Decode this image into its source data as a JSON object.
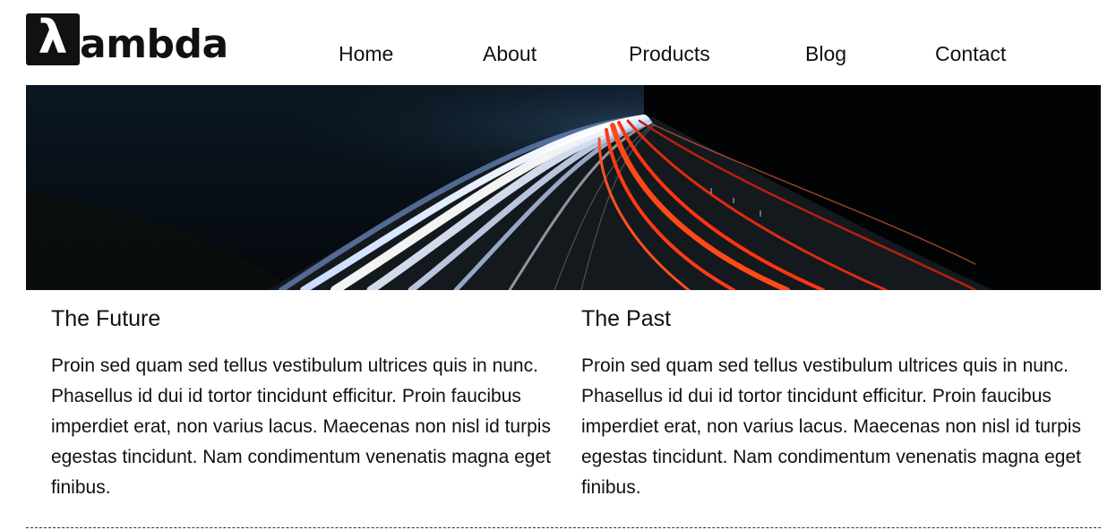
{
  "header": {
    "logo": {
      "mark": "λ",
      "word": "ambda"
    },
    "nav": [
      {
        "label": "Home"
      },
      {
        "label": "About"
      },
      {
        "label": "Products"
      },
      {
        "label": "Blog"
      },
      {
        "label": "Contact"
      }
    ]
  },
  "hero": {
    "image": "highway-light-trails-night"
  },
  "columns": [
    {
      "title": "The Future",
      "body": "Proin sed quam sed tellus vestibulum ultrices quis in nunc. Phasellus id dui id tortor tincidunt efficitur. Proin faucibus imperdiet erat, non varius lacus. Maecenas non nisl id turpis egestas tincidunt. Nam condimentum venenatis magna eget finibus."
    },
    {
      "title": "The Past",
      "body": "Proin sed quam sed tellus vestibulum ultrices quis in nunc. Phasellus id dui id tortor tincidunt efficitur. Proin faucibus imperdiet erat, non varius lacus. Maecenas non nisl id turpis egestas tincidunt. Nam condimentum venenatis magna eget finibus."
    }
  ],
  "colors": {
    "text": "#111111",
    "background": "#ffffff",
    "trail_white": "#e9f1ff",
    "trail_red": "#ff3a14"
  }
}
